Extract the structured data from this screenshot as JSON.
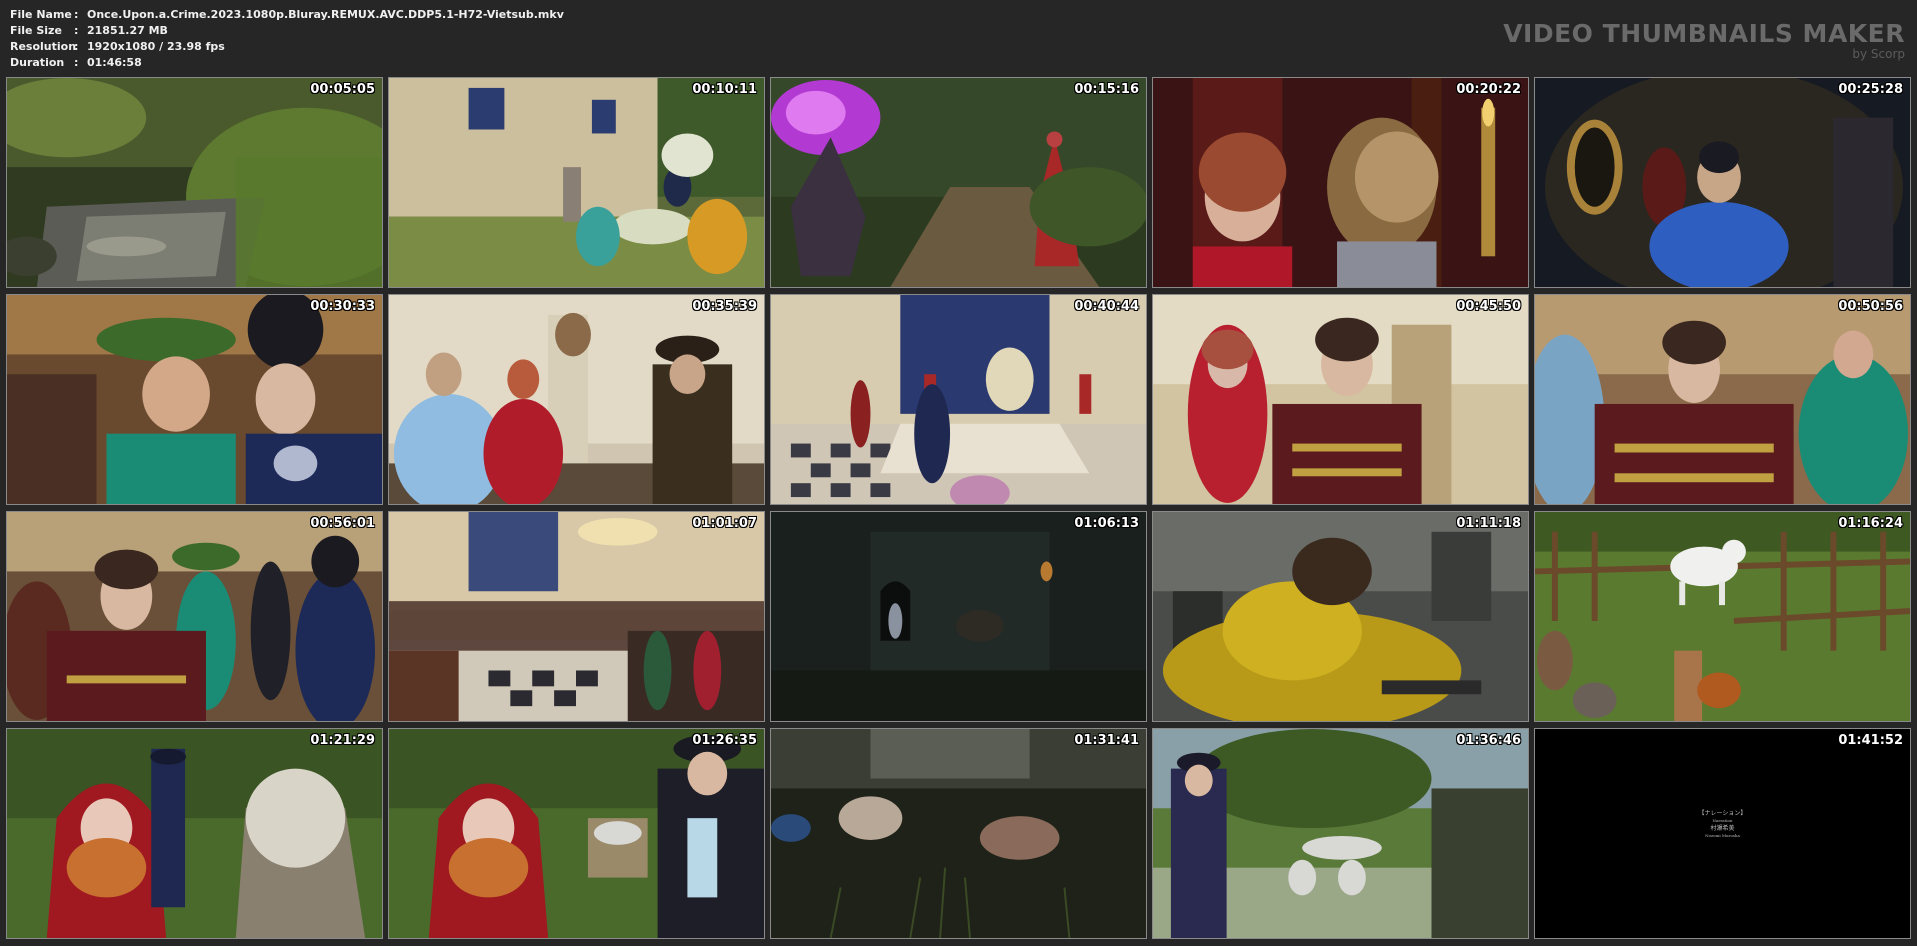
{
  "meta": {
    "rows": [
      {
        "key": "File Name",
        "sep": ":",
        "value": "Once.Upon.a.Crime.2023.1080p.Bluray.REMUX.AVC.DDP5.1-H72-Vietsub.mkv"
      },
      {
        "key": "File Size",
        "sep": ":",
        "value": "21851.27 MB"
      },
      {
        "key": "Resolution",
        "sep": ":",
        "value": "1920x1080 / 23.98 fps"
      },
      {
        "key": "Duration",
        "sep": ":",
        "value": "01:46:58"
      }
    ]
  },
  "brand": {
    "title": "VIDEO THUMBNAILS MAKER",
    "subtitle": "by Scorp"
  },
  "thumbnails": [
    {
      "time": "00:05:05",
      "scene": "forest-stream"
    },
    {
      "time": "00:10:11",
      "scene": "garden-tea-party"
    },
    {
      "time": "00:15:16",
      "scene": "magic-forest-path"
    },
    {
      "time": "00:20:22",
      "scene": "two-women-red-curtain"
    },
    {
      "time": "00:25:28",
      "scene": "pumpkin-carriage-interior"
    },
    {
      "time": "00:30:33",
      "scene": "ball-crowd-hats"
    },
    {
      "time": "00:35:39",
      "scene": "palace-hall-conversation"
    },
    {
      "time": "00:40:44",
      "scene": "throne-room"
    },
    {
      "time": "00:45:50",
      "scene": "prince-and-girl"
    },
    {
      "time": "00:50:56",
      "scene": "prince-ballroom"
    },
    {
      "time": "00:56:01",
      "scene": "prince-with-guests"
    },
    {
      "time": "01:01:07",
      "scene": "grand-ballroom"
    },
    {
      "time": "01:06:13",
      "scene": "dark-castle-night"
    },
    {
      "time": "01:11:18",
      "scene": "yellow-gown-floor"
    },
    {
      "time": "01:16:24",
      "scene": "goat-pen"
    },
    {
      "time": "01:21:29",
      "scene": "red-hood-and-guard"
    },
    {
      "time": "01:26:35",
      "scene": "red-hood-and-officer"
    },
    {
      "time": "01:31:41",
      "scene": "bare-feet-grass"
    },
    {
      "time": "01:36:46",
      "scene": "garden-man-in-coat"
    },
    {
      "time": "01:41:52",
      "scene": "end-credits",
      "credit_lines": [
        "【ナレーション】",
        "Narration",
        "村瀬希美",
        "Nozomi Murosha"
      ]
    }
  ],
  "colors": {
    "background": "#262626",
    "tile_border": "#8a8a8a",
    "brand": "#6a6a6a"
  }
}
